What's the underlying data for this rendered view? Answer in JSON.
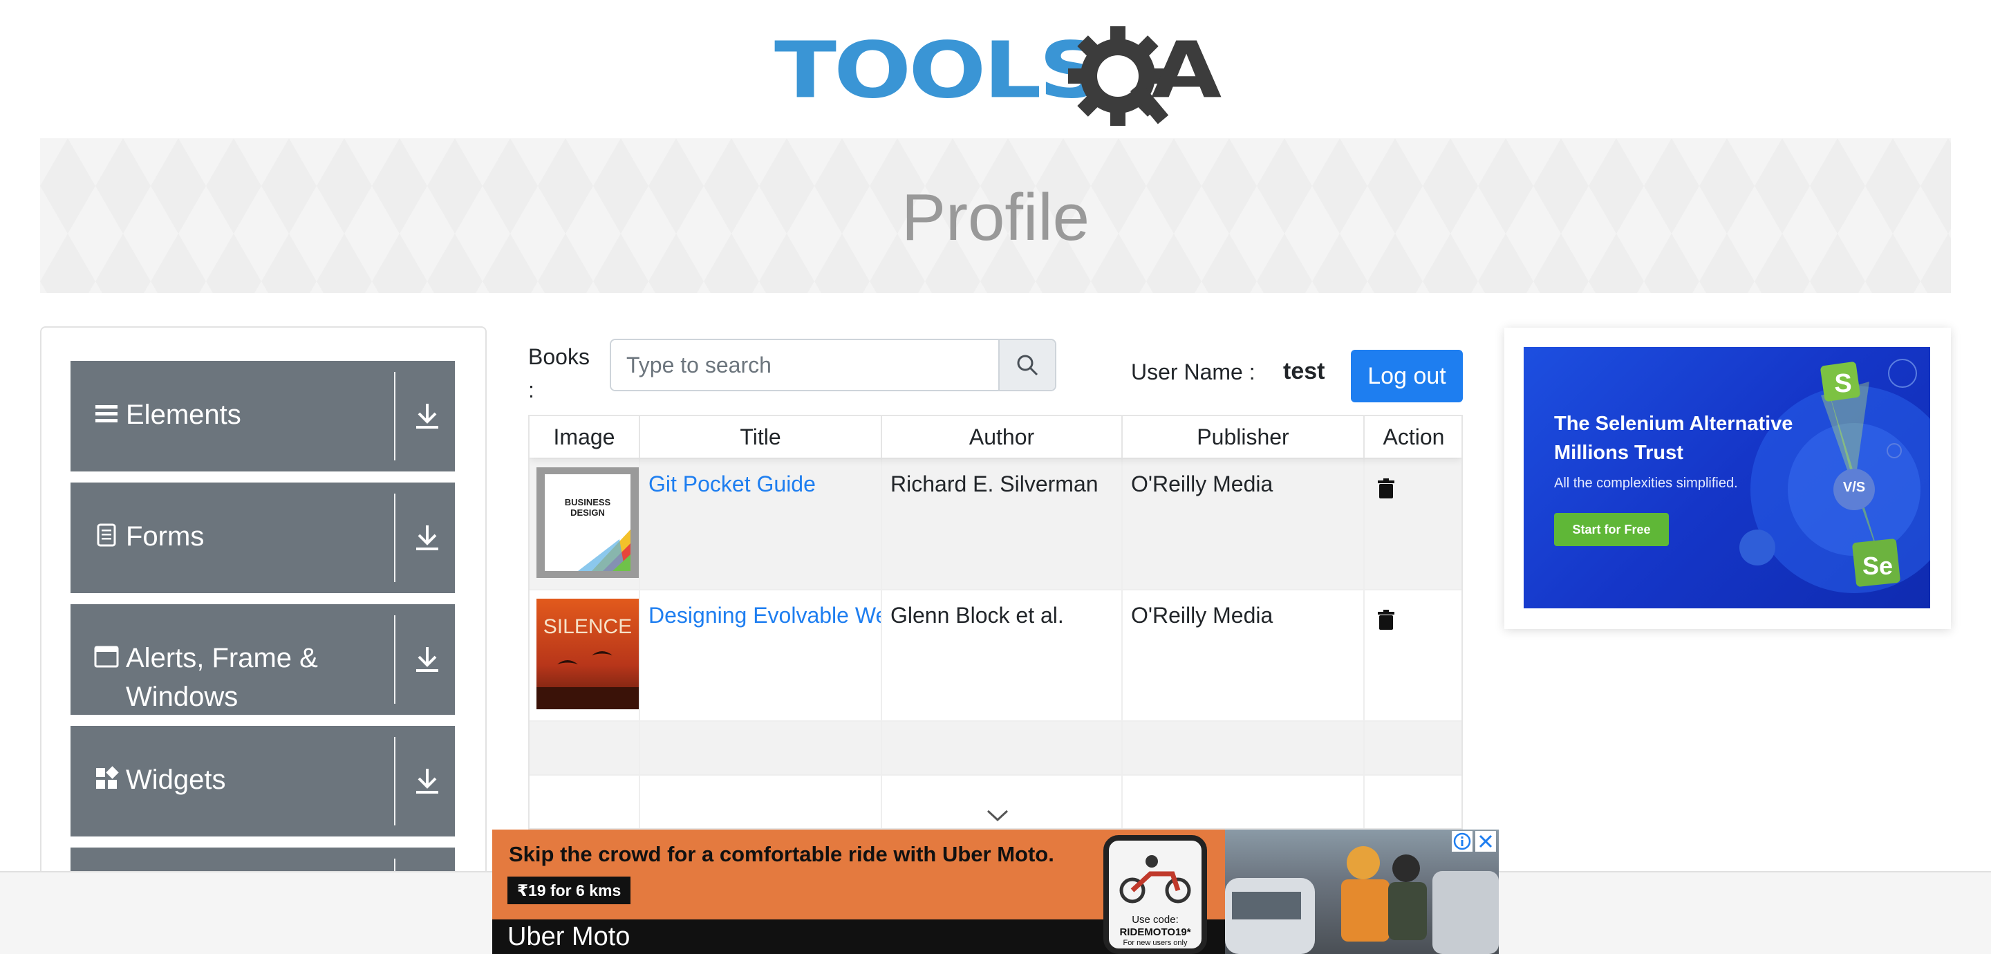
{
  "logo": {
    "text": "TOOLS",
    "a_letter": "A"
  },
  "banner": {
    "title": "Profile"
  },
  "sidebar": {
    "groups": [
      {
        "label": "Elements",
        "icon": "hamburger-icon"
      },
      {
        "label": "Forms",
        "icon": "document-icon"
      },
      {
        "label": "Alerts, Frame & Windows",
        "icon": "window-icon"
      },
      {
        "label": "Widgets",
        "icon": "widgets-icon"
      }
    ]
  },
  "books": {
    "label": "Books :",
    "search": {
      "placeholder": "Type to search",
      "value": ""
    },
    "user_label": "User Name :",
    "user_value": "test",
    "logout_label": "Log out",
    "table": {
      "headers": [
        "Image",
        "Title",
        "Author",
        "Publisher",
        "Action"
      ],
      "rows": [
        {
          "title": "Git Pocket Guide",
          "author": "Richard E. Silverman",
          "publisher": "O'Reilly Media"
        },
        {
          "title": "Designing Evolvable We",
          "author": "Glenn Block et al.",
          "publisher": "O'Reilly Media"
        }
      ]
    }
  },
  "ad_right": {
    "title": "The Selenium Alternative Millions Trust",
    "subtitle": "All the complexities simplified.",
    "cta": "Start for Free",
    "badge_s": "S",
    "badge_vs": "V/S",
    "badge_se": "Se"
  },
  "ad_bottom": {
    "headline": "Skip the crowd for a comfortable ride with Uber Moto.",
    "price": "₹19 for 6 kms",
    "brand": "Uber Moto",
    "use_code": "Use code:",
    "code": "RIDEMOTO19*",
    "code_note": "For new users only"
  },
  "colors": {
    "sidebar_group_bg": "#6c757d",
    "link_blue": "#1e7ef0",
    "logo_blue": "#3a95d5",
    "ad_blue": "#1d4fe0",
    "uber_orange": "#e47a3f"
  }
}
